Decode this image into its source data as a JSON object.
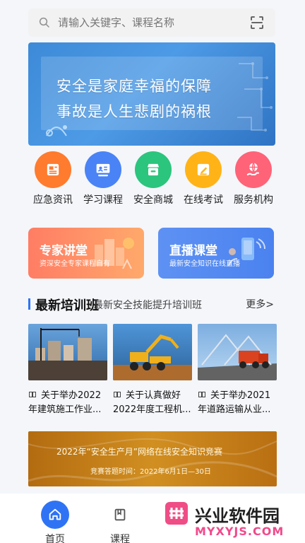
{
  "search": {
    "placeholder": "请输入关键字、课程名称"
  },
  "banner": {
    "line1": "安全是家庭幸福的保障",
    "line2": "事故是人生悲剧的祸根"
  },
  "menu": {
    "items": [
      {
        "label": "应急资讯",
        "icon": "newspaper-icon",
        "color": "#ff7b2e"
      },
      {
        "label": "学习课程",
        "icon": "teacher-icon",
        "color": "#4a83f6"
      },
      {
        "label": "安全商城",
        "icon": "store-icon",
        "color": "#2bc57d"
      },
      {
        "label": "在线考试",
        "icon": "pencil-icon",
        "color": "#ffb317"
      },
      {
        "label": "服务机构",
        "icon": "globe-hand-icon",
        "color": "#ff6378"
      }
    ]
  },
  "promos": [
    {
      "title": "专家讲堂",
      "subtitle": "资深安全专家课程自有",
      "icon": "building-icon",
      "color": "#ff8c68"
    },
    {
      "title": "直播课堂",
      "subtitle": "最新安全知识在线直播",
      "icon": "live-stream-icon",
      "color": "#5c8ff3"
    }
  ],
  "section": {
    "title": "最新培训班",
    "subtitle": "最新安全技能提升培训班",
    "more": "更多>"
  },
  "courses": [
    {
      "title": "关于举办2022年建筑施工作业...",
      "image": "construction-site",
      "icon": "book-icon"
    },
    {
      "title": "关于认真做好2022年度工程机...",
      "image": "excavator",
      "icon": "book-icon"
    },
    {
      "title": "关于举办2021年道路运输从业...",
      "image": "truck-bridge",
      "icon": "book-icon"
    }
  ],
  "competition": {
    "title": "2022年“安全生产月”网络在线安全知识竞赛",
    "time": "竞赛答题时间：2022年6月1日—30日"
  },
  "bottom_bar": {
    "tabs": [
      {
        "label": "首页",
        "icon": "home-icon",
        "active": true
      },
      {
        "label": "课程",
        "icon": "bookmark-icon",
        "active": false
      }
    ]
  },
  "watermark": {
    "title": "兴业软件园",
    "site": "MYXYJS.COM"
  },
  "colors": {
    "primary": "#2f73f5",
    "background": "#f4f6fa"
  }
}
